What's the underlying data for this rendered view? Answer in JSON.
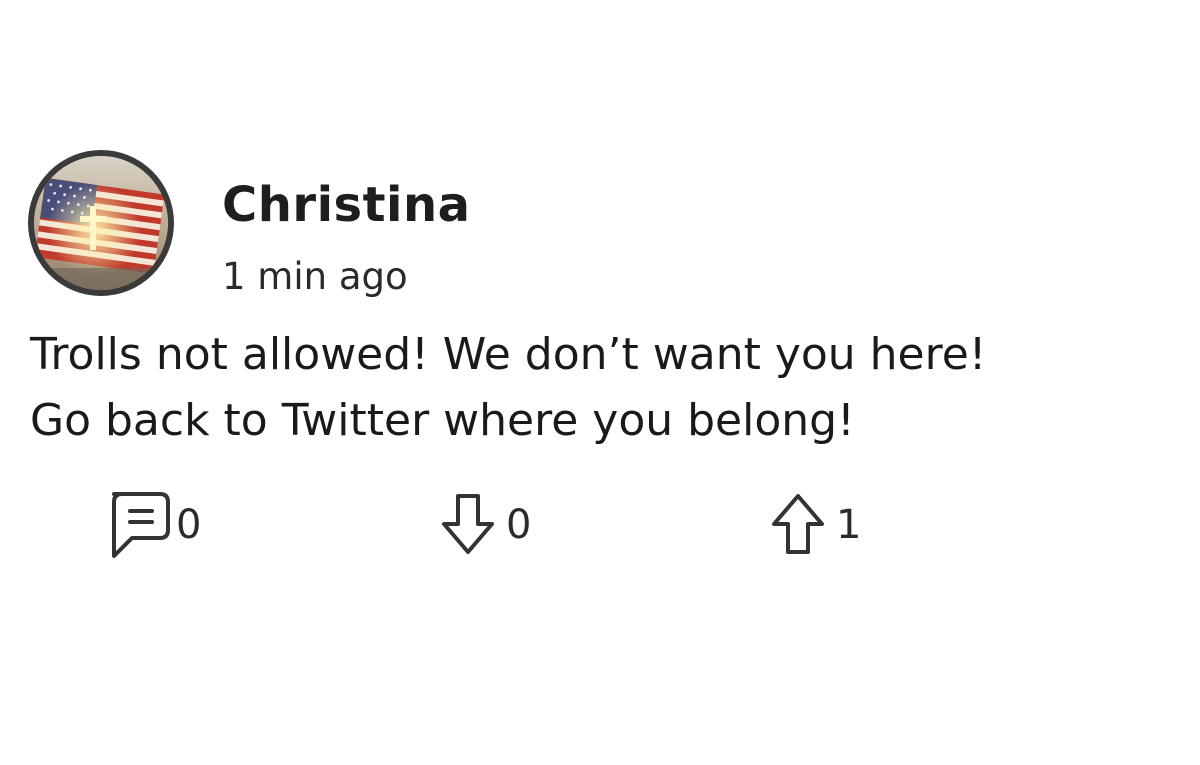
{
  "post": {
    "username": "Christina",
    "timestamp": "1 min ago",
    "body_lines": [
      "Trolls not allowed! We don’t want you here!",
      "Go back to Twitter where you belong!"
    ],
    "avatar_icon": "american-flag-with-cross-avatar"
  },
  "actions": {
    "reply": {
      "icon": "comment-icon",
      "count": "0"
    },
    "downvote": {
      "icon": "arrow-down-icon",
      "count": "0"
    },
    "upvote": {
      "icon": "arrow-up-icon",
      "count": "1"
    }
  },
  "colors": {
    "text": "#1a1a1a",
    "avatar_border": "#3a3a3a",
    "icon_stroke": "#333333"
  }
}
